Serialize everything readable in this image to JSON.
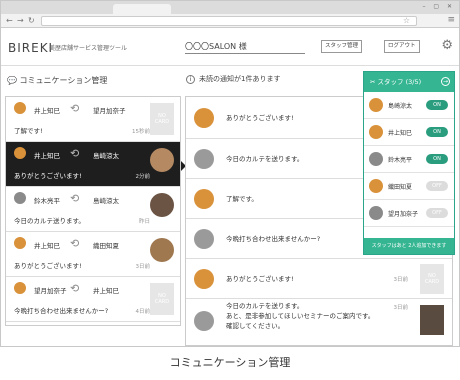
{
  "app": {
    "logo": "BIREKI",
    "tagline": "美歴店舗サービス管理ツール",
    "salon": "〇〇〇SALON 様"
  },
  "header": {
    "staff_btn": "スタッフ管理",
    "logout_btn": "ログアウト"
  },
  "left": {
    "title": "コミュニケーション管理",
    "threads": [
      {
        "from": "井上知巳",
        "to": "望月加奈子",
        "message": "了解です!",
        "time": "15秒前",
        "nocard": "NO\nCARD"
      },
      {
        "from": "井上知巳",
        "to": "島崎涼太",
        "message": "ありがとうございます!",
        "time": "2分前"
      },
      {
        "from": "鈴木亮平",
        "to": "島崎涼太",
        "message": "今日のカルテ送ります。",
        "time": "昨日"
      },
      {
        "from": "井上知巳",
        "to": "織田知夏",
        "message": "ありがとうございます!",
        "time": "3日前"
      },
      {
        "from": "望月加奈子",
        "to": "井上知巳",
        "message": "今晩打ち合わせ出来ませんかー?",
        "time": "4日前",
        "nocard": "NO\nCARD"
      }
    ]
  },
  "right": {
    "notice": "未読の通知が1件あります",
    "messages": [
      {
        "text": "ありがとうございます!"
      },
      {
        "text": "今日のカルテを送ります。"
      },
      {
        "text": "了解です。"
      },
      {
        "text": "今晩打ち合わせ出来ませんかー?"
      },
      {
        "text": "ありがとうございます!",
        "time": "3日前",
        "nocard": "NO\nCARD"
      },
      {
        "text": "今日のカルテを送ります。\nあと、是非参加してほしいセミナーのご案内です。\n確認してください。",
        "time": "3日前"
      }
    ]
  },
  "staff": {
    "title": "スタッフ (3/5)",
    "members": [
      {
        "name": "島崎涼太",
        "status": "ON"
      },
      {
        "name": "井上知巳",
        "status": "ON"
      },
      {
        "name": "鈴木亮平",
        "status": "ON"
      },
      {
        "name": "織田知夏",
        "status": "OFF"
      },
      {
        "name": "望月加奈子",
        "status": "OFF"
      }
    ],
    "footer": "スタッフはあと 2人追加できます"
  },
  "caption": "コミュニケーション管理"
}
